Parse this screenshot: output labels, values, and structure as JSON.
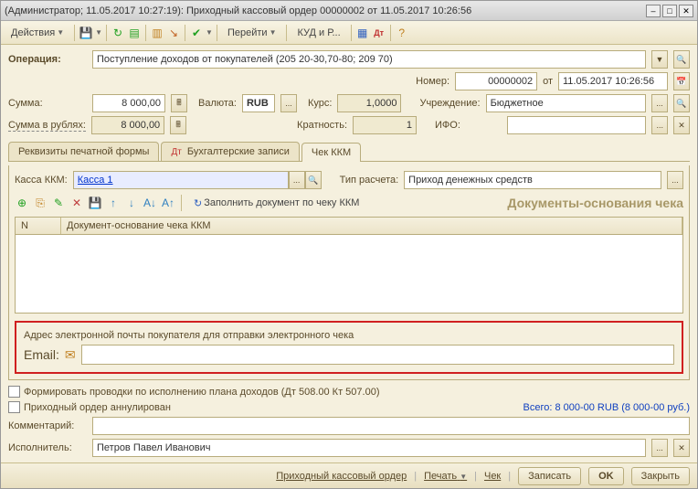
{
  "titlebar": {
    "text": "(Администратор; 11.05.2017 10:27:19): Приходный кассовый ордер 00000002 от 11.05.2017 10:26:56"
  },
  "toolbar": {
    "actions": "Действия",
    "goto": "Перейти",
    "kudir": "КУД и Р..."
  },
  "operation": {
    "label": "Операция:",
    "value": "Поступление доходов от покупателей (205 20-30,70-80; 209 70)"
  },
  "header": {
    "number_label": "Номер:",
    "number_value": "00000002",
    "from_label": "от",
    "date_value": "11.05.2017 10:26:56",
    "sum_label": "Сумма:",
    "sum_value": "8 000,00",
    "currency_label": "Валюта:",
    "currency_value": "RUB",
    "rate_label": "Курс:",
    "rate_value": "1,0000",
    "org_label": "Учреждение:",
    "org_value": "Бюджетное",
    "sum_rub_label": "Сумма в рублях:",
    "sum_rub_value": "8 000,00",
    "mult_label": "Кратность:",
    "mult_value": "1",
    "ifo_label": "ИФО:",
    "ifo_value": ""
  },
  "tabs": {
    "t1": "Реквизиты печатной формы",
    "t2": "Бухгалтерские записи",
    "t3": "Чек ККМ"
  },
  "kkm": {
    "kassa_label": "Касса ККМ:",
    "kassa_value": "Касса 1",
    "type_label": "Тип расчета:",
    "type_value": "Приход денежных средств",
    "fill_btn": "Заполнить документ по чеку ККМ",
    "docs_title": "Документы-основания чека",
    "col_n": "N",
    "col_doc": "Документ-основание чека ККМ"
  },
  "email": {
    "desc": "Адрес электронной почты покупателя для отправки электронного чека",
    "label": "Email:"
  },
  "checks": {
    "c1": "Формировать проводки по исполнению плана доходов (Дт 508.00 Кт 507.00)",
    "c2": "Приходный ордер аннулирован"
  },
  "total": "Всего: 8 000-00 RUB (8 000-00 руб.)",
  "comment_label": "Комментарий:",
  "executor_label": "Исполнитель:",
  "executor_value": "Петров Павел Иванович",
  "footer": {
    "link": "Приходный кассовый ордер",
    "print": "Печать",
    "check": "Чек",
    "save": "Записать",
    "ok": "OK",
    "close": "Закрыть"
  }
}
